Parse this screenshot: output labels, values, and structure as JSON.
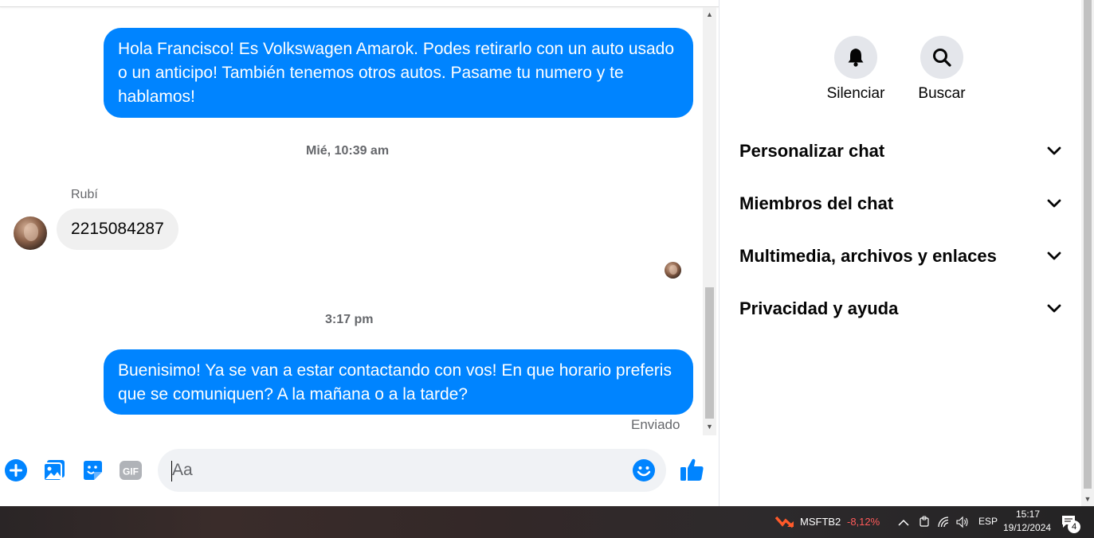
{
  "messages": {
    "outgoing_1": "Hola Francisco! Es Volkswagen Amarok. Podes retirarlo con un auto usado o un anticipo! También tenemos otros autos. Pasame tu numero y te hablamos!",
    "timestamp_1": "Mié, 10:39 am",
    "incoming_sender": "Rubí",
    "incoming_1": "2215084287",
    "timestamp_2": "3:17 pm",
    "outgoing_2": "Buenisimo! Ya se van a estar contactando con vos! En que horario preferis que se comuniquen? A la mañana o a la tarde?",
    "status": "Enviado"
  },
  "composer": {
    "placeholder": "Aa",
    "icons": [
      "plus-icon",
      "photo-icon",
      "sticker-icon",
      "gif-icon",
      "emoji-icon",
      "like-icon"
    ],
    "gif_label": "GIF"
  },
  "right_panel": {
    "mute_label": "Silenciar",
    "search_label": "Buscar",
    "sections": [
      "Personalizar chat",
      "Miembros del chat",
      "Multimedia, archivos y enlaces",
      "Privacidad y ayuda"
    ]
  },
  "taskbar": {
    "stock_symbol": "MSFTB2",
    "stock_change": "-8,12%",
    "language": "ESP",
    "time": "15:17",
    "date": "19/12/2024",
    "notification_count": "4"
  },
  "colors": {
    "accent": "#0084ff",
    "incoming_bubble": "#f0f0f0",
    "stock_negative": "#ff5a5a"
  }
}
